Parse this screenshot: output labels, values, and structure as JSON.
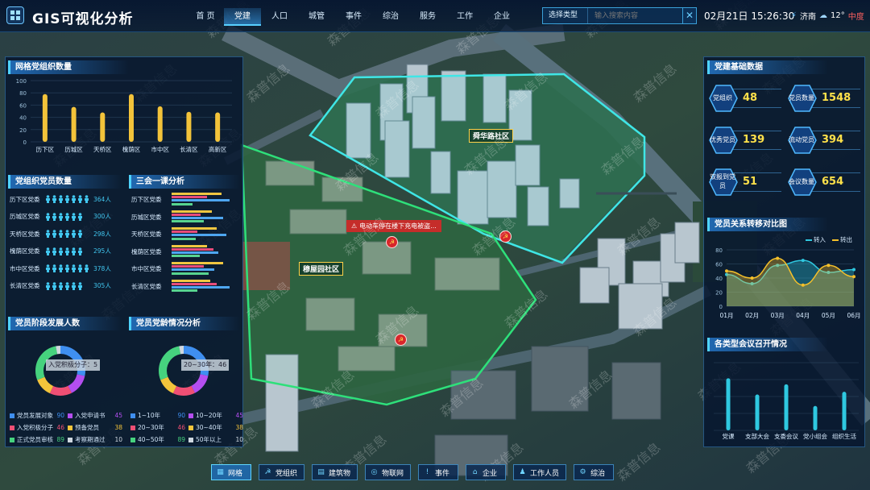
{
  "app": {
    "title": "GIS可视化分析"
  },
  "nav": {
    "items": [
      "首 页",
      "党建",
      "人口",
      "城管",
      "事件",
      "综治",
      "服务",
      "工作",
      "企业"
    ],
    "active": 1
  },
  "search": {
    "type_label": "选择类型",
    "placeholder": "输入搜索内容",
    "clear": "✕"
  },
  "header": {
    "datetime": "02月21日 15:26:30",
    "city": "济南",
    "temperature": "12°",
    "air_quality": "中度"
  },
  "map": {
    "community_1": "舜华路社区",
    "community_2": "穆屋园社区",
    "alert": "电动车停在楼下充电被盗...",
    "party_symbol": "☭"
  },
  "panel_grid": {
    "title": "网格党组织数量",
    "chart_data": {
      "type": "bar",
      "categories": [
        "历下区",
        "历城区",
        "天桥区",
        "槐荫区",
        "市中区",
        "长清区",
        "高新区"
      ],
      "values": [
        78,
        57,
        48,
        78,
        58,
        49,
        48
      ],
      "ylim": [
        0,
        100
      ],
      "yticks": [
        0,
        20,
        40,
        60,
        80,
        100
      ]
    }
  },
  "panel_members": {
    "title": "党组织党员数量",
    "rows": [
      {
        "label": "历下区党委",
        "value": "364人",
        "icons": 7
      },
      {
        "label": "历城区党委",
        "value": "300人",
        "icons": 6
      },
      {
        "label": "天桥区党委",
        "value": "298人",
        "icons": 6
      },
      {
        "label": "槐荫区党委",
        "value": "295人",
        "icons": 6
      },
      {
        "label": "市中区党委",
        "value": "378人",
        "icons": 7
      },
      {
        "label": "长清区党委",
        "value": "305人",
        "icons": 6
      }
    ]
  },
  "panel_sanhui": {
    "title": "三会一课分析",
    "rows": [
      "历下区党委",
      "历城区党委",
      "天桥区党委",
      "槐荫区党委",
      "市中区党委",
      "长清区党委"
    ],
    "bar_colors": [
      "#f0c640",
      "#e74c7a",
      "#4ea6f0",
      "#57d48f"
    ],
    "bar_fractions": [
      [
        0.78,
        0.55,
        0.9,
        0.32
      ],
      [
        0.62,
        0.45,
        0.8,
        0.5
      ],
      [
        0.7,
        0.4,
        0.85,
        0.38
      ],
      [
        0.55,
        0.65,
        0.72,
        0.44
      ],
      [
        0.8,
        0.5,
        0.66,
        0.58
      ],
      [
        0.6,
        0.7,
        0.9,
        0.4
      ]
    ]
  },
  "panel_stage": {
    "title": "党员阶段发展人数",
    "center_label": "入党积极分子：5",
    "legend": [
      {
        "label": "党员发展对象",
        "value": "90",
        "color": "#3f8ff0"
      },
      {
        "label": "入党申请书",
        "value": "45",
        "color": "#b44ef0"
      },
      {
        "label": "入党积极分子",
        "value": "46",
        "color": "#ef4f74"
      },
      {
        "label": "预备党员",
        "value": "38",
        "color": "#f3c43b"
      },
      {
        "label": "正式党员审核",
        "value": "89",
        "color": "#46d27e"
      },
      {
        "label": "考察期通过",
        "value": "10",
        "color": "#cfd8e0"
      }
    ],
    "donut": [
      {
        "value": 90,
        "color": "#3f8ff0"
      },
      {
        "value": 45,
        "color": "#b44ef0"
      },
      {
        "value": 46,
        "color": "#ef4f74"
      },
      {
        "value": 38,
        "color": "#f3c43b"
      },
      {
        "value": 89,
        "color": "#46d27e"
      },
      {
        "value": 10,
        "color": "#cfd8e0"
      }
    ]
  },
  "panel_age": {
    "title": "党员党龄情况分析",
    "center_label": "20~30年：46",
    "legend": [
      {
        "label": "1~10年",
        "value": "90",
        "color": "#3f8ff0"
      },
      {
        "label": "10~20年",
        "value": "45",
        "color": "#b44ef0"
      },
      {
        "label": "20~30年",
        "value": "46",
        "color": "#ef4f74"
      },
      {
        "label": "30~40年",
        "value": "38",
        "color": "#f3c43b"
      },
      {
        "label": "40~50年",
        "value": "89",
        "color": "#46d27e"
      },
      {
        "label": "50年以上",
        "value": "10",
        "color": "#cfd8e0"
      }
    ],
    "donut": [
      {
        "value": 90,
        "color": "#3f8ff0"
      },
      {
        "value": 45,
        "color": "#b44ef0"
      },
      {
        "value": 46,
        "color": "#ef4f74"
      },
      {
        "value": 38,
        "color": "#f3c43b"
      },
      {
        "value": 89,
        "color": "#46d27e"
      },
      {
        "value": 10,
        "color": "#cfd8e0"
      }
    ]
  },
  "panel_basic": {
    "title": "党建基础数据",
    "tiles": [
      {
        "label": "党组织",
        "value": "48"
      },
      {
        "label": "党员数量",
        "value": "1548"
      },
      {
        "label": "优秀党员",
        "value": "139"
      },
      {
        "label": "流动党员",
        "value": "394"
      },
      {
        "label": "双报到党员",
        "value": "51"
      },
      {
        "label": "会议数量",
        "value": "654"
      }
    ]
  },
  "panel_transfer": {
    "title": "党员关系转移对比图",
    "chart_data": {
      "type": "area",
      "x": [
        "01月",
        "02月",
        "03月",
        "04月",
        "05月",
        "06月"
      ],
      "series": [
        {
          "name": "转入",
          "values": [
            45,
            32,
            58,
            65,
            48,
            52
          ],
          "color": "#2fc8e0"
        },
        {
          "name": "转出",
          "values": [
            50,
            40,
            68,
            30,
            58,
            42
          ],
          "color": "#f5c02a"
        }
      ],
      "ylim": [
        0,
        80
      ],
      "yticks": [
        0,
        20,
        40,
        60,
        80
      ]
    }
  },
  "panel_meeting": {
    "title": "各类型会议召开情况",
    "chart_data": {
      "type": "bar",
      "categories": [
        "党课",
        "支部大会",
        "支委会议",
        "党小组会",
        "组织生活"
      ],
      "values": [
        77,
        53,
        68,
        36,
        57
      ],
      "ylim": [
        0,
        100
      ]
    }
  },
  "bottom": {
    "items": [
      {
        "label": "网格",
        "icon": "▦"
      },
      {
        "label": "党组织",
        "icon": "☭"
      },
      {
        "label": "建筑物",
        "icon": "▤"
      },
      {
        "label": "物联网",
        "icon": "◎"
      },
      {
        "label": "事件",
        "icon": "!"
      },
      {
        "label": "企业",
        "icon": "⌂"
      },
      {
        "label": "工作人员",
        "icon": "♟"
      },
      {
        "label": "综治",
        "icon": "⚙"
      }
    ],
    "active": 0
  },
  "watermark": {
    "text": "森普信息"
  }
}
